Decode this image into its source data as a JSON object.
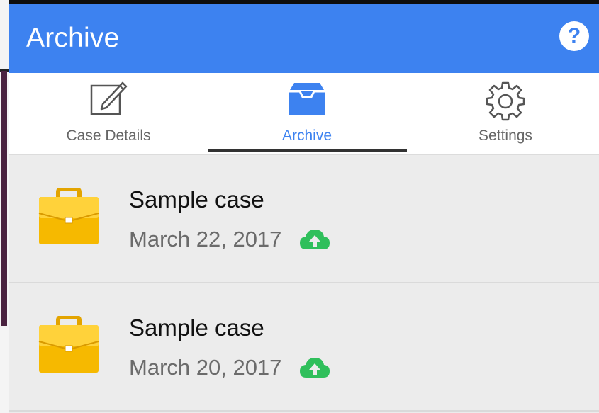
{
  "appbar": {
    "title": "Archive",
    "help_label": "?"
  },
  "tabs": [
    {
      "label": "Case Details",
      "icon": "edit-icon",
      "active": false
    },
    {
      "label": "Archive",
      "icon": "archive-icon",
      "active": true
    },
    {
      "label": "Settings",
      "icon": "gear-icon",
      "active": false
    }
  ],
  "cases": [
    {
      "title": "Sample case",
      "date": "March 22, 2017",
      "icon": "briefcase-icon",
      "status_icon": "cloud-upload-icon"
    },
    {
      "title": "Sample case",
      "date": "March 20, 2017",
      "icon": "briefcase-icon",
      "status_icon": "cloud-upload-icon"
    }
  ],
  "colors": {
    "accent": "#3d82f0",
    "upload_green": "#2fbf5b",
    "briefcase": "#f6b900"
  }
}
